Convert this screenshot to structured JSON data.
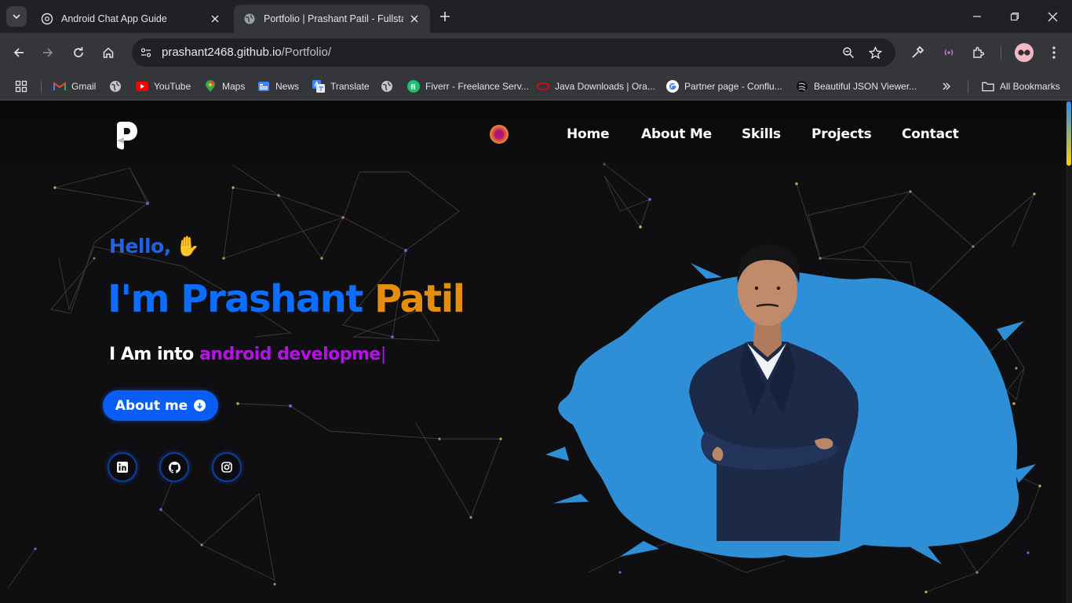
{
  "browser": {
    "tabs": [
      {
        "title": "Android Chat App Guide",
        "active": false
      },
      {
        "title": "Portfolio | Prashant Patil - Fullstack",
        "active": true
      }
    ],
    "url_host": "prashant2468.github.io",
    "url_path": "/Portfolio/",
    "bookmarks": [
      {
        "label": "Gmail",
        "icon": "gmail-icon"
      },
      {
        "label": "YouTube",
        "icon": "youtube-icon"
      },
      {
        "label": "Maps",
        "icon": "maps-icon"
      },
      {
        "label": "News",
        "icon": "news-icon"
      },
      {
        "label": "Translate",
        "icon": "translate-icon"
      },
      {
        "label": "Fiverr - Freelance Serv...",
        "icon": "fiverr-icon"
      },
      {
        "label": "Java Downloads | Ora...",
        "icon": "oracle-icon"
      },
      {
        "label": "Partner page - Conflu...",
        "icon": "google-icon"
      },
      {
        "label": "Beautiful JSON Viewer...",
        "icon": "json-viewer-icon"
      }
    ],
    "all_bookmarks": "All Bookmarks"
  },
  "site": {
    "nav": [
      "Home",
      "About Me",
      "Skills",
      "Projects",
      "Contact"
    ],
    "hello": "Hello,",
    "name_first": "I'm Prashant",
    "name_last": "Patil",
    "typed_prefix": "I Am into",
    "typed_text": "android developme",
    "typed_caret": "|",
    "about_button": "About me",
    "socials": [
      "linkedin-icon",
      "github-icon",
      "instagram-icon"
    ]
  },
  "colors": {
    "accent_blue": "#0d6efd",
    "accent_orange": "#e38e0c",
    "accent_purple": "#b412e6",
    "splash_blue": "#2f8fd6"
  }
}
